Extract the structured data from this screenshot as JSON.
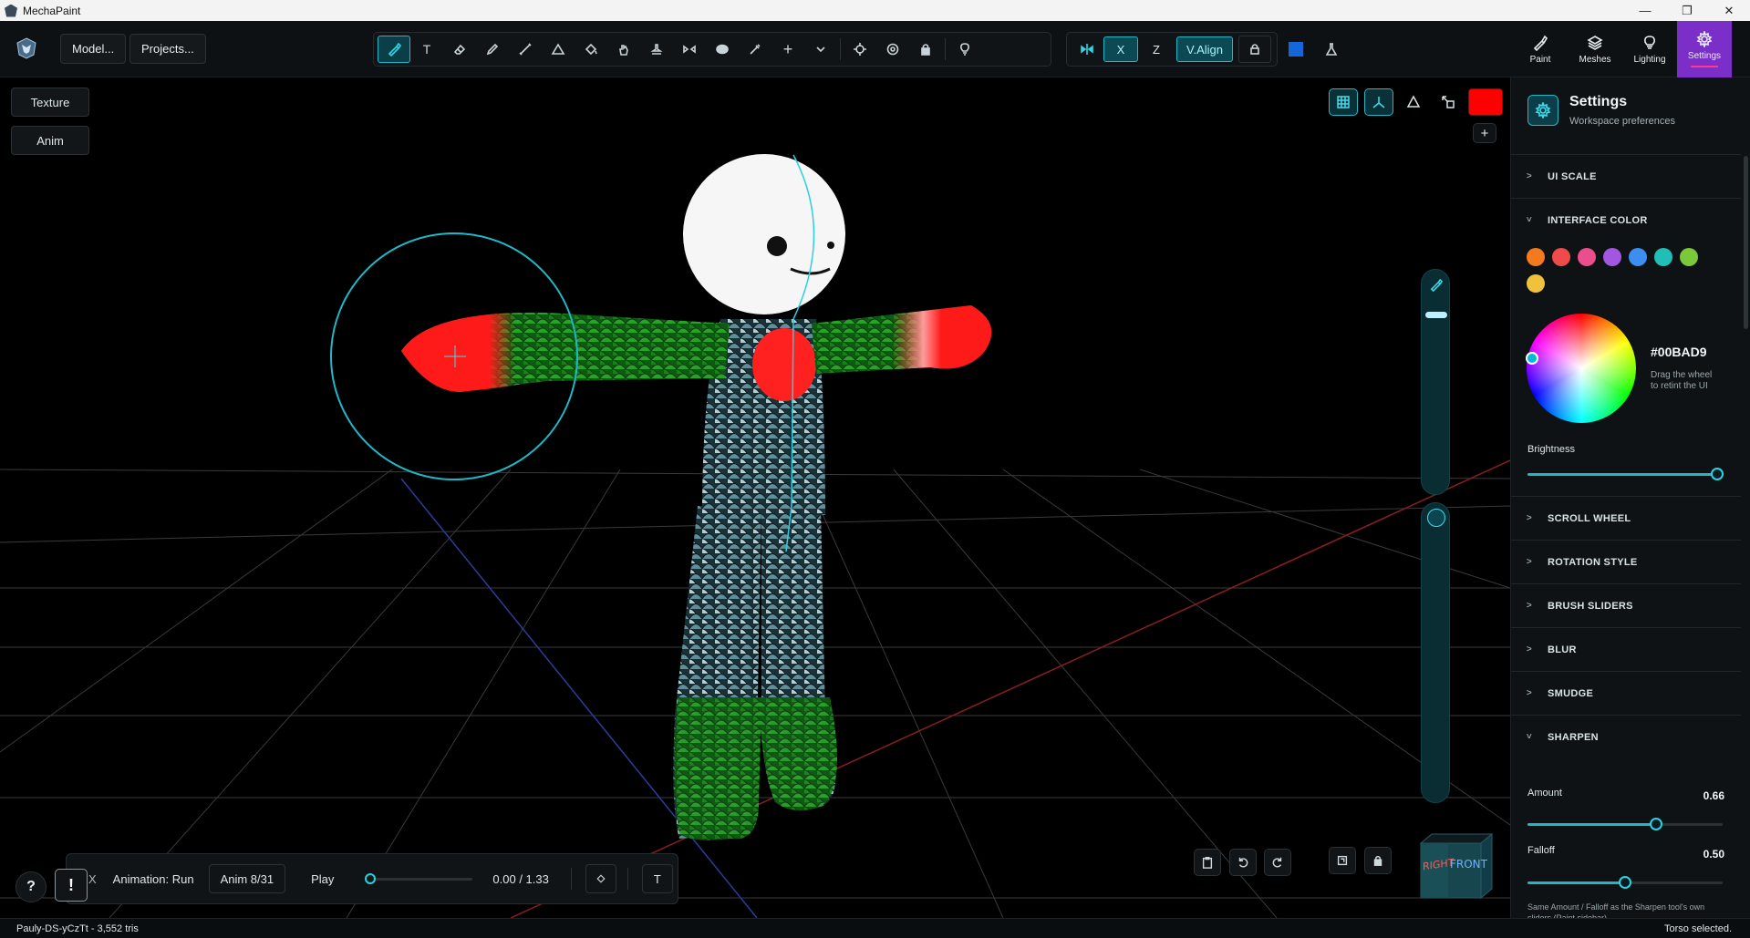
{
  "window": {
    "title": "MechaPaint",
    "controls": [
      "—",
      "❐",
      "✕"
    ]
  },
  "topbar": {
    "model_btn": "Model...",
    "projects_btn": "Projects...",
    "x_label": "X",
    "z_label": "Z",
    "valign_label": "V.Align",
    "text_tool_glyph": "T",
    "plus_glyph": "+"
  },
  "modes": [
    {
      "label": "Paint",
      "icon": "brush-icon"
    },
    {
      "label": "Meshes",
      "icon": "layers-icon"
    },
    {
      "label": "Lighting",
      "icon": "bulb-icon"
    },
    {
      "label": "Settings",
      "icon": "gear-icon"
    }
  ],
  "left": {
    "texture_btn": "Texture",
    "anim_btn": "Anim"
  },
  "animation": {
    "close": "X",
    "name": "Animation: Run",
    "counter": "Anim 8/31",
    "play": "Play",
    "time": "0.00 / 1.33",
    "progress": 0.0,
    "t_btn": "T"
  },
  "viewport": {
    "add_btn": "+",
    "cube_right": "RIGHT",
    "cube_front": "FRONT",
    "paint_color": "#ff0000"
  },
  "corner": {
    "help": "?",
    "alert": "!"
  },
  "panel": {
    "title": "Settings",
    "subtitle": "Workspace preferences",
    "sections": {
      "ui_scale": "UI SCALE",
      "interface_color": "INTERFACE COLOR",
      "scroll_wheel": "SCROLL WHEEL",
      "rotation_style": "ROTATION STYLE",
      "brush_sliders": "BRUSH SLIDERS",
      "blur": "BLUR",
      "smudge": "SMUDGE",
      "sharpen": "SHARPEN"
    },
    "chev_collapsed": ">",
    "chev_expanded": "˅",
    "swatches": [
      "#f47a20",
      "#ef4b4b",
      "#ea4e8c",
      "#a356e2",
      "#3b8ff0",
      "#1fbfb8",
      "#7bc83a",
      "#f0c23c"
    ],
    "hex": "#00BAD9",
    "hex_hint_1": "Drag the wheel",
    "hex_hint_2": "to retint the UI",
    "brightness_label": "Brightness",
    "brightness": 1.0,
    "amount_label": "Amount",
    "amount": "0.66",
    "falloff_label": "Falloff",
    "falloff": "0.50",
    "footnote": "Same Amount / Falloff as the Sharpen tool's own sliders (Paint sidebar)"
  },
  "status": {
    "left": "Pauly-DS-yCzTt  -  3,552 tris",
    "right": "Torso selected."
  }
}
